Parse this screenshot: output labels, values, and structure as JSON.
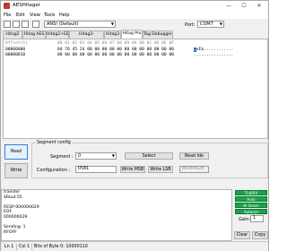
{
  "window": {
    "title": "AESHitager",
    "minimize": "—",
    "maximize": "☐",
    "close": "✕"
  },
  "menu": [
    "File",
    "Edit",
    "View",
    "Tools",
    "Help"
  ],
  "toolbar": {
    "encoding": "ANSI (Default)",
    "port_label": "Port:",
    "port_value": "COM7"
  },
  "tabs": [
    "Hitag2",
    "Hitag AES",
    "Hitag2+EE",
    "Hitag2-Extended",
    "Hitag3",
    "Hitag Pro",
    "Tag Debugger"
  ],
  "active_tab": "Hitag Pro",
  "hex": {
    "header_offset": "Offset(h)",
    "header_cols": "00 01 02 03 04 05 06 07 08 09 0A 0B 0C 0D 0E 0F",
    "rows": [
      {
        "offset": "00000000",
        "bytes": "84 76 45 24 00 00 00 00 00 00 00 00 00 00 00 00",
        "ascii": "„vE$............"
      },
      {
        "offset": "00000010",
        "bytes": "00 00 00 00 00 00 00 00 00 00 00 00 00 00 00 00",
        "ascii": "................"
      }
    ],
    "ascii_selected": "„"
  },
  "buttons": {
    "read": "Read",
    "write": "Write",
    "select": "Select",
    "read_ide": "Read Ide",
    "write_msb": "Write MSB",
    "write_lsb": "Write LSB"
  },
  "segment": {
    "legend": "Segment config",
    "segment_label": "Segment :",
    "segment_value": "0",
    "config_label": "Configuration :",
    "config_value": "0581",
    "ide_value": "84764524"
  },
  "log": [
    "transfer",
    "SRout:55",
    "",
    "RESP:000000029",
    "EOF",
    "000000029",
    "",
    "Sending: 1",
    "RFOFF"
  ],
  "side": {
    "leds": [
      "TLK/RX",
      "Auto",
      "Hi Sense",
      "Autorun"
    ],
    "gain_label": "Gain:",
    "gain_value": "1",
    "clear": "Clear",
    "copy": "Copy"
  },
  "status": {
    "line": "Ln 1",
    "col": "Col 1",
    "bits": "Bits of Byte 0: 10000110"
  }
}
